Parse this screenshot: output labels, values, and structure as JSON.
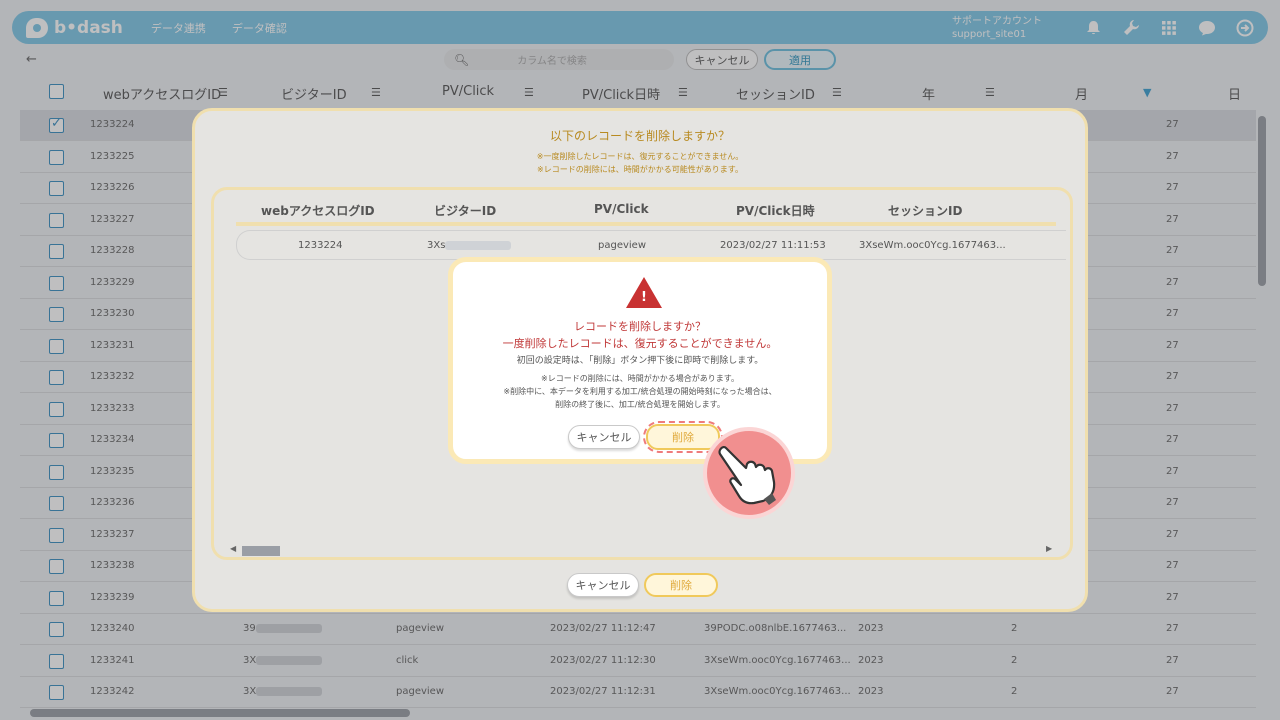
{
  "header": {
    "logo_text": "b•dash",
    "nav": [
      "データ連携",
      "データ確認"
    ],
    "account_line1": "サポートアカウント",
    "account_line2": "support_site01"
  },
  "toolbar": {
    "search_placeholder": "カラム名で検索",
    "cancel_label": "キャンセル",
    "apply_label": "適用"
  },
  "table": {
    "columns": [
      "webアクセスログID",
      "ビジターID",
      "PV/Click",
      "PV/Click日時",
      "セッションID",
      "年",
      "月",
      "日"
    ],
    "rows": [
      {
        "id": "1233224",
        "day": "27",
        "checked": true
      },
      {
        "id": "1233225",
        "day": "27"
      },
      {
        "id": "1233226",
        "day": "27"
      },
      {
        "id": "1233227",
        "day": "27"
      },
      {
        "id": "1233228",
        "day": "27"
      },
      {
        "id": "1233229",
        "day": "27"
      },
      {
        "id": "1233230",
        "day": "27"
      },
      {
        "id": "1233231",
        "day": "27"
      },
      {
        "id": "1233232",
        "day": "27"
      },
      {
        "id": "1233233",
        "day": "27"
      },
      {
        "id": "1233234",
        "day": "27"
      },
      {
        "id": "1233235",
        "day": "27"
      },
      {
        "id": "1233236",
        "day": "27"
      },
      {
        "id": "1233237",
        "day": "27"
      },
      {
        "id": "1233238",
        "day": "27"
      },
      {
        "id": "1233239",
        "day": "27"
      },
      {
        "id": "1233240",
        "visitor": "39",
        "pv": "pageview",
        "datetime": "2023/02/27 11:12:47",
        "session": "39PODC.o08nlbE.1677463...",
        "year": "2023",
        "month": "2",
        "day": "27"
      },
      {
        "id": "1233241",
        "visitor": "3X",
        "pv": "click",
        "datetime": "2023/02/27 11:12:30",
        "session": "3XseWm.ooc0Ycg.1677463...",
        "year": "2023",
        "month": "2",
        "day": "27"
      },
      {
        "id": "1233242",
        "visitor": "3X",
        "pv": "pageview",
        "datetime": "2023/02/27 11:12:31",
        "session": "3XseWm.ooc0Ycg.1677463...",
        "year": "2023",
        "month": "2",
        "day": "27"
      }
    ]
  },
  "delete_dialog": {
    "title": "以下のレコードを削除しますか？",
    "note1": "※一度削除したレコードは、復元することができません。",
    "note2": "※レコードの削除には、時間がかかる可能性があります。",
    "columns": [
      "webアクセスログID",
      "ビジターID",
      "PV/Click",
      "PV/Click日時",
      "セッションID"
    ],
    "row": {
      "id": "1233224",
      "visitor": "3Xs",
      "pv": "pageview",
      "datetime": "2023/02/27 11:11:53",
      "session": "3XseWm.ooc0Ycg.1677463..."
    },
    "cancel_label": "キャンセル",
    "delete_label": "削除"
  },
  "confirm_dialog": {
    "title": "レコードを削除しますか？",
    "main": "一度削除したレコードは、復元することができません。",
    "info": "初回の設定時は、「削除」ボタン押下後に即時で削除します。",
    "small1": "※レコードの削除には、時間がかかる場合があります。",
    "small2": "※削除中に、本データを利用する加工/統合処理の開始時刻になった場合は、",
    "small3": "削除の終了後に、加工/統合処理を開始します。",
    "cancel_label": "キャンセル",
    "delete_label": "削除"
  },
  "colors": {
    "header": "#7fc7e6",
    "warning": "#c83232",
    "accent_gold": "#f0c95b",
    "pointer": "#f18f8f"
  }
}
